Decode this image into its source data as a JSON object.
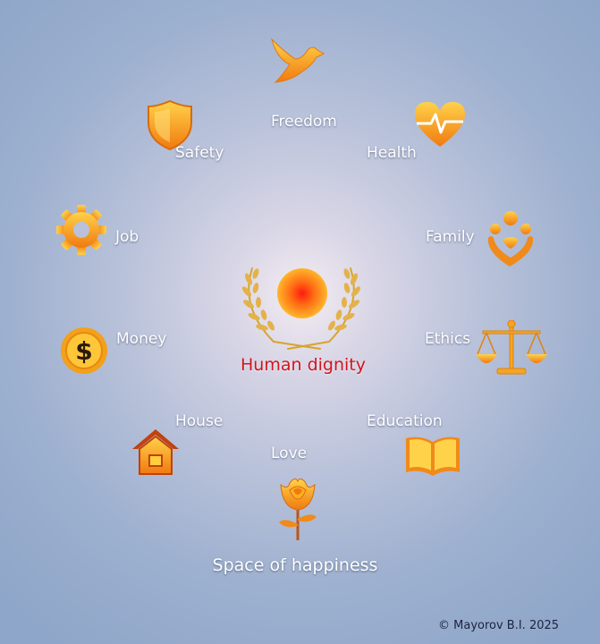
{
  "center": {
    "label": "Human dignity",
    "icon": "sun-laurel-icon"
  },
  "footer": {
    "title": "Space of happiness",
    "copyright": "© Mayorov B.I.  2025"
  },
  "nodes": {
    "freedom": {
      "label": "Freedom",
      "icon": "dove-icon"
    },
    "health": {
      "label": "Health",
      "icon": "heart-pulse-icon"
    },
    "family": {
      "label": "Family",
      "icon": "family-heart-icon"
    },
    "ethics": {
      "label": "Ethics",
      "icon": "scales-icon"
    },
    "education": {
      "label": "Education",
      "icon": "open-book-icon"
    },
    "love": {
      "label": "Love",
      "icon": "rose-icon"
    },
    "house": {
      "label": "House",
      "icon": "house-icon"
    },
    "money": {
      "label": "Money",
      "icon": "dollar-coin-icon"
    },
    "job": {
      "label": "Job",
      "icon": "gear-icon"
    },
    "safety": {
      "label": "Safety",
      "icon": "shield-icon"
    }
  },
  "colors": {
    "accent": "#f7a21a",
    "icon_dark": "#e9720e",
    "center_text": "#d3141c",
    "label_text": "#ffffff"
  }
}
